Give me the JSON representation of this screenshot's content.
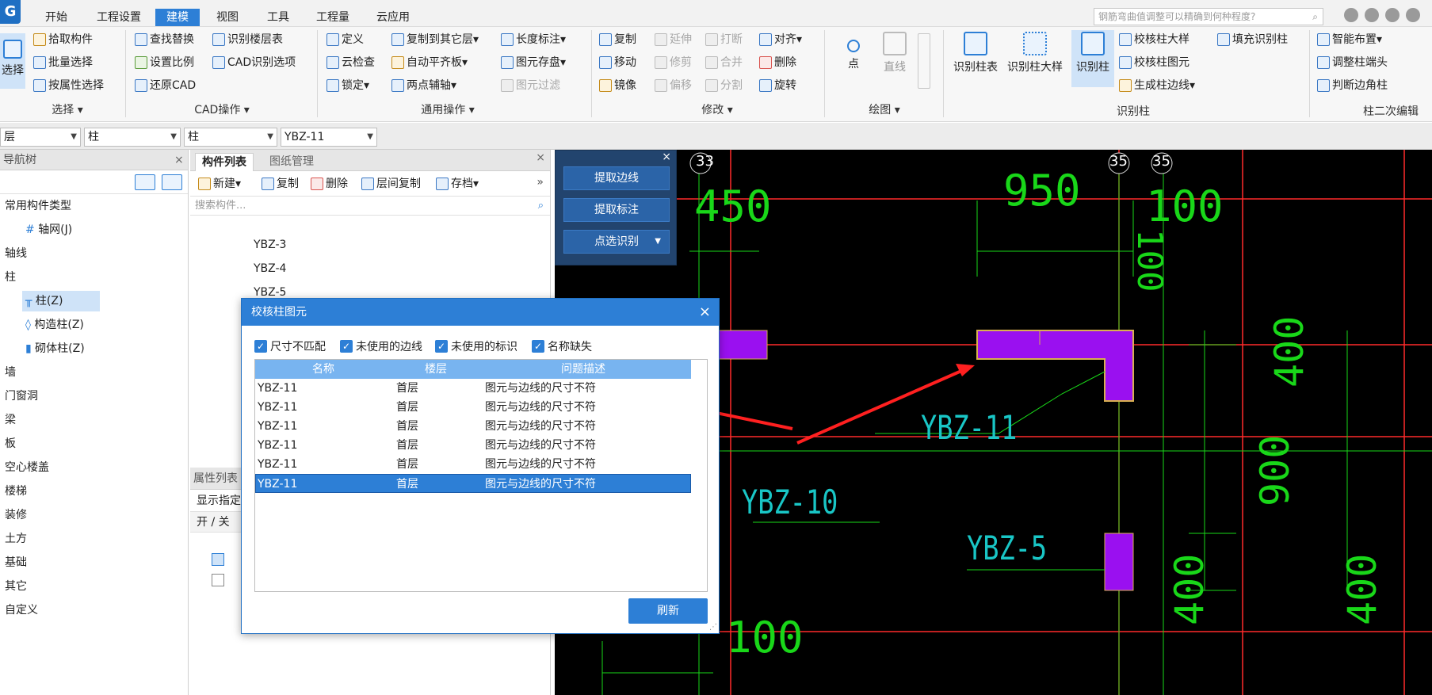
{
  "menu": [
    "开始",
    "工程设置",
    "建模",
    "视图",
    "工具",
    "工程量",
    "云应用"
  ],
  "menu_active": "建模",
  "search_placeholder": "钢筋弯曲值调整可以精确到何种程度?",
  "ribbon": {
    "select": {
      "big": "选择",
      "items": [
        "拾取构件",
        "批量选择",
        "按属性选择"
      ],
      "group": "选择"
    },
    "cad": {
      "items": [
        "查找替换",
        "设置比例",
        "还原CAD",
        "识别楼层表",
        "CAD识别选项"
      ],
      "group": "CAD操作"
    },
    "common": {
      "items": [
        "定义",
        "云检查",
        "锁定",
        "复制到其它层",
        "自动平齐板",
        "两点辅轴",
        "长度标注",
        "图元存盘",
        "图元过滤"
      ],
      "group": "通用操作"
    },
    "modify": {
      "items": [
        "复制",
        "延伸",
        "打断",
        "对齐",
        "移动",
        "修剪",
        "合并",
        "删除",
        "镜像",
        "偏移",
        "分割",
        "旋转"
      ],
      "group": "修改"
    },
    "draw": {
      "items": [
        "点",
        "直线"
      ],
      "group": "绘图"
    },
    "recognize": {
      "items": [
        "识别柱表",
        "识别柱大样",
        "识别柱",
        "校核柱大样",
        "填充识别柱",
        "校核柱图元",
        "生成柱边线"
      ],
      "group": "识别柱"
    },
    "secondary": {
      "items": [
        "智能布置",
        "调整柱端头",
        "判断边角柱"
      ],
      "group": "柱二次编辑"
    }
  },
  "selectors": [
    "层",
    "柱",
    "柱",
    "YBZ-11"
  ],
  "nav": {
    "title": "导航树",
    "items": [
      "常用构件类型",
      "轴网(J)",
      "轴线",
      "柱",
      "柱(Z)",
      "构造柱(Z)",
      "砌体柱(Z)",
      "墙",
      "门窗洞",
      "梁",
      "板",
      "空心楼盖",
      "楼梯",
      "装修",
      "土方",
      "基础",
      "其它",
      "自定义"
    ]
  },
  "component_list": {
    "tabs": [
      "构件列表",
      "图纸管理"
    ],
    "toolbar": [
      "新建",
      "复制",
      "删除",
      "层间复制",
      "存档"
    ],
    "search_placeholder": "搜索构件...",
    "items": [
      "YBZ-3",
      "YBZ-4",
      "YBZ-5"
    ]
  },
  "attr_panel": {
    "title": "属性列表",
    "show_label": "显示指定",
    "col": "开 / 关"
  },
  "float_panel": [
    "提取边线",
    "提取标注",
    "点选识别"
  ],
  "dialog": {
    "title": "校核柱图元",
    "checks": [
      "尺寸不匹配",
      "未使用的边线",
      "未使用的标识",
      "名称缺失"
    ],
    "headers": [
      "名称",
      "楼层",
      "问题描述"
    ],
    "rows": [
      {
        "name": "YBZ-11",
        "floor": "首层",
        "desc": "图元与边线的尺寸不符"
      },
      {
        "name": "YBZ-11",
        "floor": "首层",
        "desc": "图元与边线的尺寸不符"
      },
      {
        "name": "YBZ-11",
        "floor": "首层",
        "desc": "图元与边线的尺寸不符"
      },
      {
        "name": "YBZ-11",
        "floor": "首层",
        "desc": "图元与边线的尺寸不符"
      },
      {
        "name": "YBZ-11",
        "floor": "首层",
        "desc": "图元与边线的尺寸不符"
      },
      {
        "name": "YBZ-11",
        "floor": "首层",
        "desc": "图元与边线的尺寸不符"
      }
    ],
    "selected_row": 5,
    "refresh": "刷新"
  },
  "cad": {
    "axis_labels": [
      "33",
      "35",
      "35"
    ],
    "dims": [
      "450",
      "950",
      "100",
      "100",
      "400",
      "900",
      "400",
      "400",
      "100"
    ],
    "labels": [
      "YBZ-11",
      "YBZ-10",
      "YBZ-5"
    ]
  },
  "colors": {
    "accent": "#2d7fd6",
    "cad_bg": "#000000",
    "column_fill": "#9a10f0",
    "dim": "#19d719",
    "label": "#19c6c6",
    "grid": "#ff2a2a",
    "arrow": "#ff2020"
  }
}
